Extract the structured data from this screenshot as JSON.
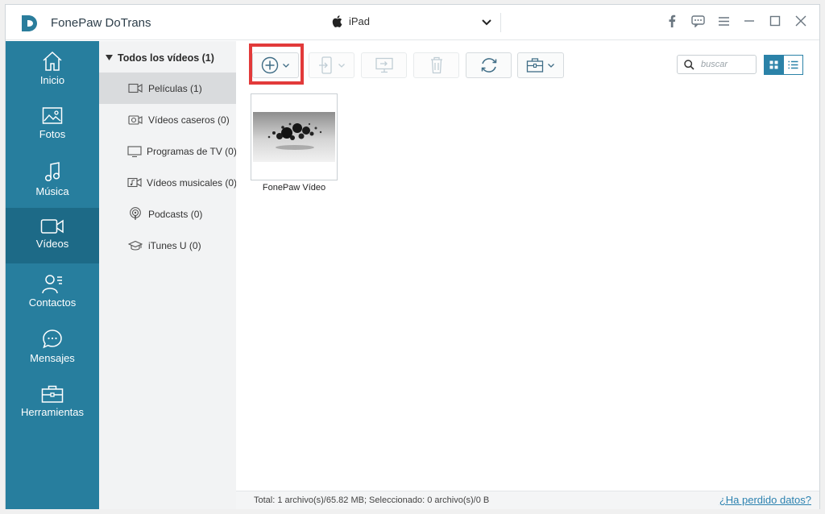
{
  "app": {
    "title": "FonePaw DoTrans"
  },
  "device": {
    "name": "iPad"
  },
  "sidebar": {
    "items": [
      {
        "label": "Inicio",
        "icon": "home-icon"
      },
      {
        "label": "Fotos",
        "icon": "photo-icon"
      },
      {
        "label": "Música",
        "icon": "music-icon"
      },
      {
        "label": "Vídeos",
        "icon": "video-icon",
        "active": true
      },
      {
        "label": "Contactos",
        "icon": "contacts-icon"
      },
      {
        "label": "Mensajes",
        "icon": "message-icon"
      },
      {
        "label": "Herramientas",
        "icon": "toolbox-icon"
      }
    ]
  },
  "subnav": {
    "header": "Todos los vídeos (1)",
    "items": [
      {
        "label": "Películas (1)",
        "icon": "movie-icon",
        "active": true
      },
      {
        "label": "Vídeos caseros (0)",
        "icon": "home-video-icon"
      },
      {
        "label": "Programas de TV (0)",
        "icon": "tv-icon"
      },
      {
        "label": "Vídeos musicales (0)",
        "icon": "music-video-icon"
      },
      {
        "label": "Podcasts (0)",
        "icon": "podcast-icon"
      },
      {
        "label": "iTunes U (0)",
        "icon": "graduation-cap-icon"
      }
    ]
  },
  "toolbar": {
    "search_placeholder": "buscar"
  },
  "files": [
    {
      "name": "FonePaw Vídeo"
    }
  ],
  "status": {
    "text": "Total: 1 archivo(s)/65.82 MB; Seleccionado: 0 archivo(s)/0 B",
    "link": "¿Ha perdido datos?"
  },
  "colors": {
    "sidebar": "#277e9e",
    "sidebar_active": "#1d6a87",
    "accent": "#2b82a8",
    "highlight": "#e23a3a"
  }
}
